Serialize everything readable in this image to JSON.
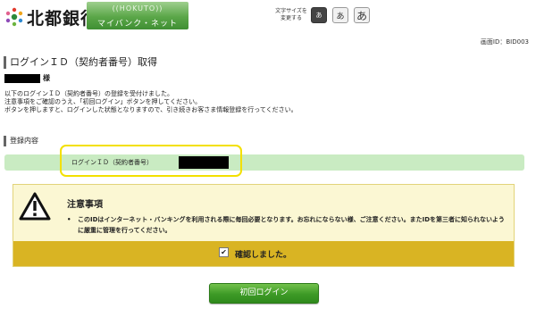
{
  "header": {
    "bank_name": "北都銀行",
    "banner_top": "((HOKUTO))",
    "banner_sub": "マイバンク・ネット",
    "font_size_label": "文字サイズを変更する",
    "font_buttons": [
      "あ",
      "あ",
      "あ"
    ],
    "active_font_index": 0
  },
  "screen_id": "画面ID：BID003",
  "title": "ログインＩＤ（契約者番号）取得",
  "customer": {
    "suffix": "様"
  },
  "message_lines": [
    "以下のログインＩＤ（契約者番号）の登録を受付けました。",
    "注意事項をご確認のうえ、「初回ログイン」ボタンを押してください。",
    "ボタンを押しますと、ログインした状態となりますので、引き続きお客さま情報登録を行ってください。"
  ],
  "section": {
    "title": "登録内容",
    "field_label": "ログインＩＤ（契約者番号）"
  },
  "notice": {
    "title": "注意事項",
    "bullet": "•",
    "text": "このIDはインターネット・バンキングを利用される際に毎回必要となります。お忘れにならない様、ご注意ください。またIDを第三者に知られないように厳重に管理を行ってください。",
    "confirm_label": "確認しました。",
    "checked": true,
    "check_mark": "✔"
  },
  "login_button": "初回ログイン",
  "colors": {
    "brand_green": "#3d9a26",
    "highlight_yellow": "#f3e000",
    "notice_bg": "#fbf7d3",
    "confirm_bg": "#d9b423"
  }
}
